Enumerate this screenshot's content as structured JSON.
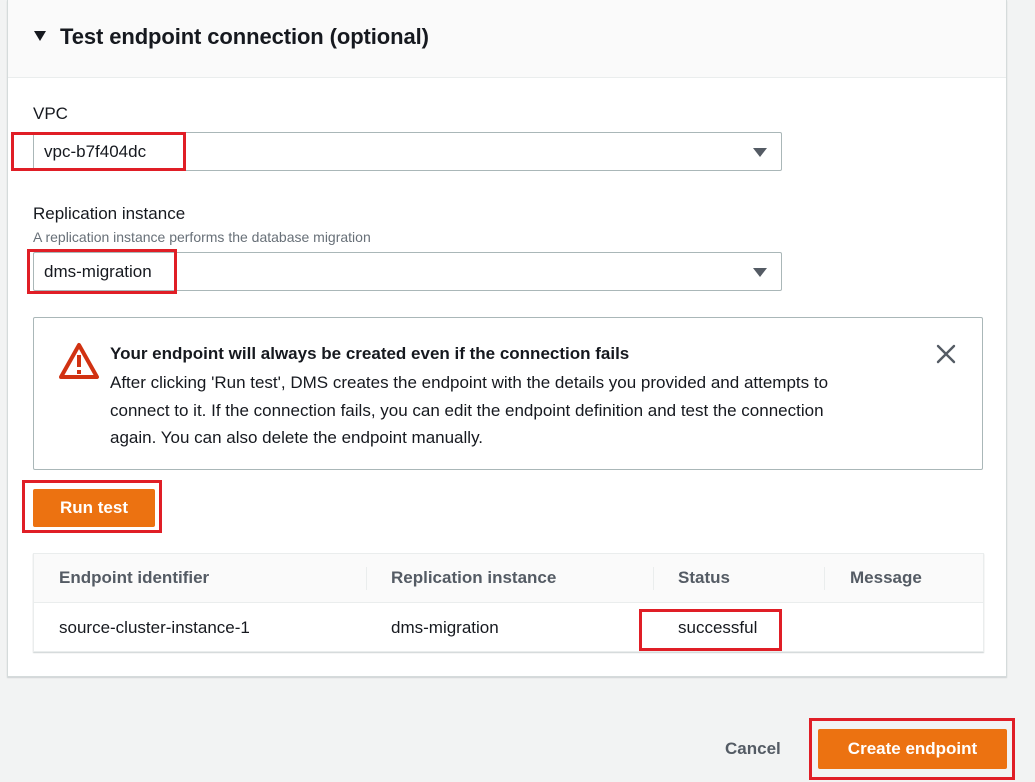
{
  "section": {
    "title": "Test endpoint connection (optional)"
  },
  "vpc": {
    "label": "VPC",
    "value": "vpc-b7f404dc"
  },
  "replication_instance": {
    "label": "Replication instance",
    "description": "A replication instance performs the database migration",
    "value": "dms-migration"
  },
  "alert": {
    "title": "Your endpoint will always be created even if the connection fails",
    "line1": "After clicking 'Run test', DMS creates the endpoint with the details you provided and attempts to",
    "line2": "connect to it. If the connection fails, you can edit the endpoint definition and test the connection",
    "line3": "again. You can also delete the endpoint manually."
  },
  "run_test_label": "Run test",
  "table": {
    "headers": [
      "Endpoint identifier",
      "Replication instance",
      "Status",
      "Message"
    ],
    "rows": [
      [
        "source-cluster-instance-1",
        "dms-migration",
        "successful",
        ""
      ]
    ]
  },
  "footer": {
    "cancel_label": "Cancel",
    "create_label": "Create endpoint"
  },
  "colors": {
    "accent_orange": "#ec7211",
    "highlight_red": "#e01e26",
    "warning_red": "#d13212"
  }
}
